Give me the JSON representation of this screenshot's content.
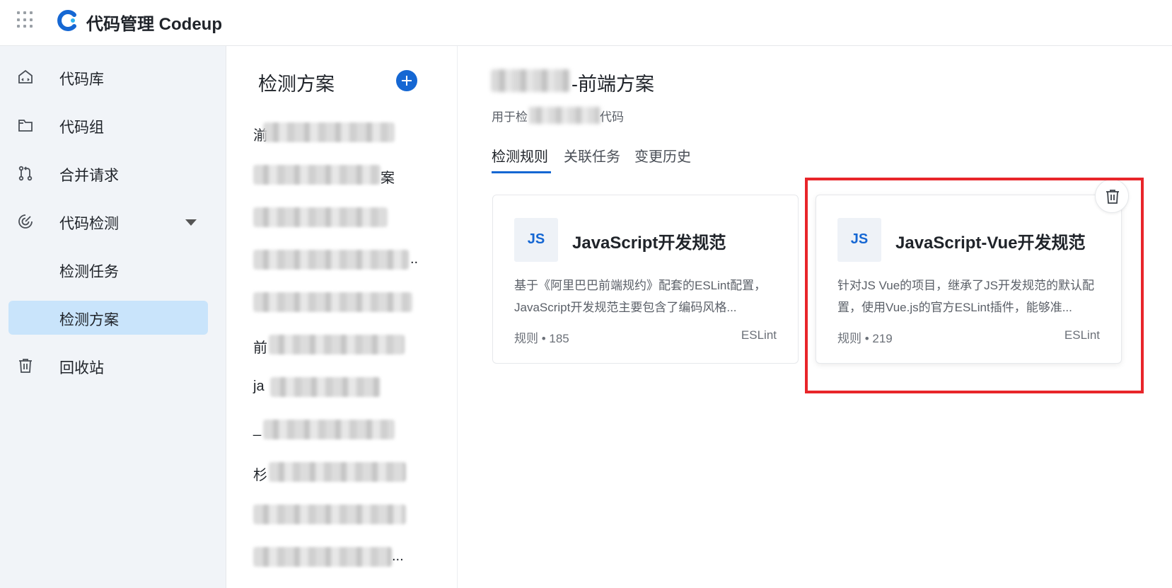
{
  "header": {
    "app_title": "代码管理 Codeup"
  },
  "sidebar": {
    "items": [
      {
        "label": "代码库",
        "icon": "repository-icon"
      },
      {
        "label": "代码组",
        "icon": "folder-icon"
      },
      {
        "label": "合并请求",
        "icon": "merge-request-icon"
      },
      {
        "label": "代码检测",
        "icon": "code-scan-icon",
        "expanded": true
      },
      {
        "label": "检测任务",
        "icon": ""
      },
      {
        "label": "检测方案",
        "icon": "",
        "active": true
      },
      {
        "label": "回收站",
        "icon": "trash-icon"
      }
    ]
  },
  "plans_panel": {
    "title": "检测方案",
    "items": [
      {
        "visible_text": "湔"
      },
      {
        "visible_text": "案"
      },
      {
        "visible_text": ""
      },
      {
        "visible_text": ".."
      },
      {
        "visible_text": ""
      },
      {
        "visible_text": "前"
      },
      {
        "visible_text": "ja"
      },
      {
        "visible_text": "_"
      },
      {
        "visible_text": "杉"
      },
      {
        "visible_text": ""
      },
      {
        "visible_text": "..."
      }
    ]
  },
  "main": {
    "plan_name_suffix": "-前端方案",
    "plan_desc_prefix": "用于检",
    "plan_desc_suffix": "代码",
    "tabs": [
      {
        "label": "检测规则",
        "active": true
      },
      {
        "label": "关联任务"
      },
      {
        "label": "变更历史"
      }
    ],
    "cards": [
      {
        "badge": "JS",
        "title": "JavaScript开发规范",
        "description": "基于《阿里巴巴前端规约》配套的ESLint配置，JavaScript开发规范主要包含了编码风格...",
        "rules": "规则 • 185",
        "engine": "ESLint"
      },
      {
        "badge": "JS",
        "title": "JavaScript-Vue开发规范",
        "description": "针对JS Vue的项目，继承了JS开发规范的默认配置，使用Vue.js的官方ESLint插件，能够准...",
        "rules": "规则 • 219",
        "engine": "ESLint"
      }
    ]
  },
  "colors": {
    "accent": "#1567d3",
    "sidebar_bg": "#f1f4f8",
    "active_nav_bg": "#c9e4fb",
    "highlight": "#e8252a"
  }
}
